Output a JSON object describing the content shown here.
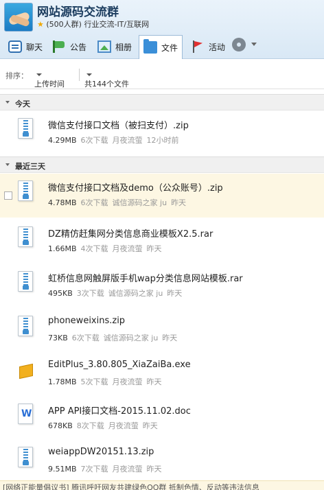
{
  "group_header": {
    "name": "网站源码交流群",
    "member_count": "(500人群)",
    "category": "行业交流-IT/互联网"
  },
  "tabs": [
    {
      "label": "聊天",
      "icon": "chat-icon"
    },
    {
      "label": "公告",
      "icon": "notice-flag-icon"
    },
    {
      "label": "相册",
      "icon": "album-icon"
    },
    {
      "label": "文件",
      "icon": "folder-icon",
      "active": true
    },
    {
      "label": "活动",
      "icon": "activity-flag-icon"
    }
  ],
  "sortbar": {
    "sort_label": "排序：",
    "sort_value": "上传时间",
    "total_label": "共144个文件"
  },
  "groups": [
    {
      "label": "今天"
    },
    {
      "label": "最近三天"
    }
  ],
  "files": [
    {
      "name": "微信支付接口文档（被扫支付）.zip",
      "size": "4.29MB",
      "downloads": "6次下载",
      "uploader": "月夜流萤",
      "time": "12小时前",
      "icon": "zip-file-icon"
    },
    {
      "name": "微信支付接口文档及demo（公众账号）.zip",
      "size": "4.78MB",
      "downloads": "6次下载",
      "uploader": "诚信源码之家 ju",
      "time": "昨天",
      "icon": "zip-file-icon"
    },
    {
      "name": "DZ精仿赶集网分类信息商业模板X2.5.rar",
      "size": "1.66MB",
      "downloads": "4次下载",
      "uploader": "月夜流萤",
      "time": "昨天",
      "icon": "zip-file-icon"
    },
    {
      "name": "虹桥信息网触屏版手机wap分类信息网站模板.rar",
      "size": "495KB",
      "downloads": "3次下载",
      "uploader": "诚信源码之家 ju",
      "time": "昨天",
      "icon": "zip-file-icon"
    },
    {
      "name": "phoneweixins.zip",
      "size": "73KB",
      "downloads": "6次下载",
      "uploader": "诚信源码之家 ju",
      "time": "昨天",
      "icon": "zip-file-icon"
    },
    {
      "name": "EditPlus_3.80.805_XiaZaiBa.exe",
      "size": "1.78MB",
      "downloads": "5次下载",
      "uploader": "月夜流萤",
      "time": "昨天",
      "icon": "exe-file-icon"
    },
    {
      "name": "APP API接口文档-2015.11.02.doc",
      "size": "678KB",
      "downloads": "8次下载",
      "uploader": "月夜流萤",
      "time": "昨天",
      "icon": "doc-file-icon"
    },
    {
      "name": "weiappDW20151.13.zip",
      "size": "9.51MB",
      "downloads": "7次下载",
      "uploader": "月夜流萤",
      "time": "昨天",
      "icon": "zip-file-icon"
    }
  ],
  "footer_text": "[网络正能量倡议书] 腾讯呼吁网友共建绿色QQ群 抵制色情、反动等违法信息"
}
